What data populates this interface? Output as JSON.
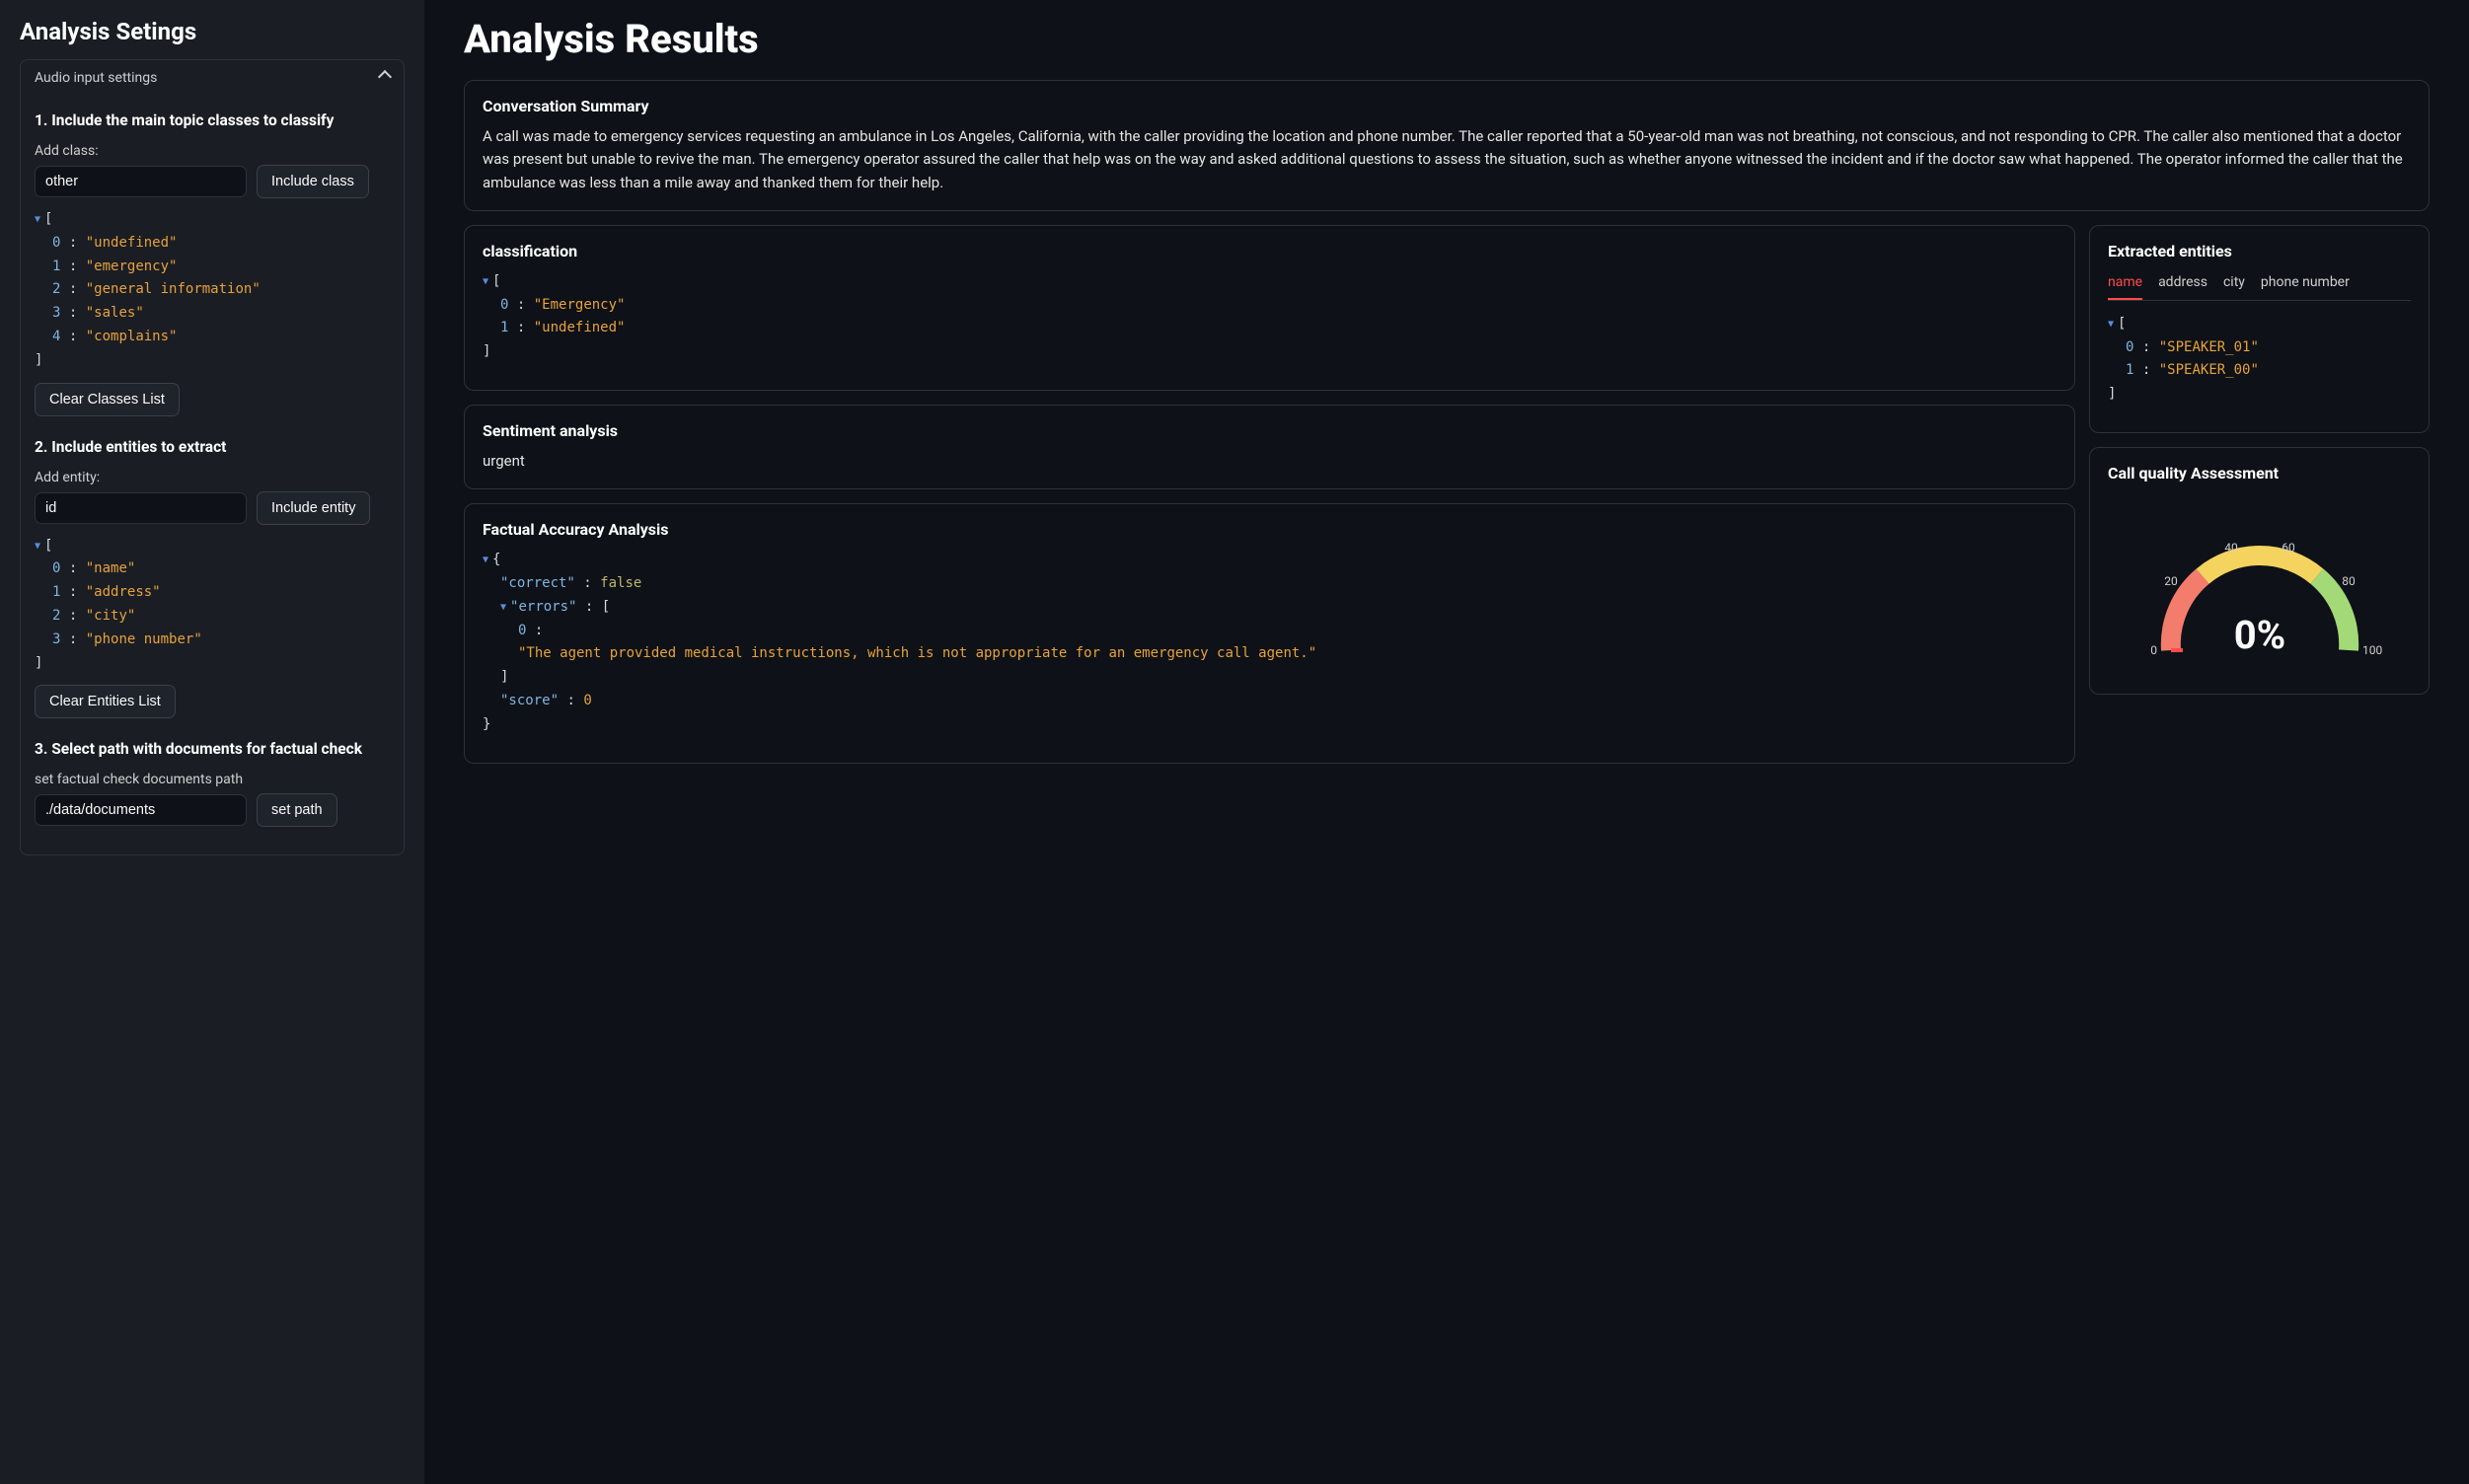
{
  "sidebar": {
    "title": "Analysis Setings",
    "accordion_label": "Audio input settings",
    "section1": {
      "title": "1. Include the main topic classes to classify",
      "add_label": "Add class:",
      "input_value": "other",
      "include_btn": "Include class",
      "classes": [
        "undefined",
        "emergency",
        "general information",
        "sales",
        "complains"
      ],
      "clear_btn": "Clear Classes List"
    },
    "section2": {
      "title": "2. Include entities to extract",
      "add_label": "Add entity:",
      "input_value": "id",
      "include_btn": "Include entity",
      "entities": [
        "name",
        "address",
        "city",
        "phone number"
      ],
      "clear_btn": "Clear Entities List"
    },
    "section3": {
      "title": "3. Select path with documents for factual check",
      "add_label": "set factual check documents path",
      "input_value": "./data/documents",
      "set_btn": "set path"
    }
  },
  "results": {
    "title": "Analysis Results",
    "summary": {
      "heading": "Conversation Summary",
      "text": "A call was made to emergency services requesting an ambulance in Los Angeles, California, with the caller providing the location and phone number. The caller reported that a 50-year-old man was not breathing, not conscious, and not responding to CPR. The caller also mentioned that a doctor was present but unable to revive the man. The emergency operator assured the caller that help was on the way and asked additional questions to assess the situation, such as whether anyone witnessed the incident and if the doctor saw what happened. The operator informed the caller that the ambulance was less than a mile away and thanked them for their help."
    },
    "classification": {
      "heading": "classification",
      "values": [
        "Emergency",
        "undefined"
      ]
    },
    "sentiment": {
      "heading": "Sentiment analysis",
      "value": "urgent"
    },
    "factual": {
      "heading": "Factual Accuracy Analysis",
      "correct": false,
      "error_text": "\"The agent provided medical instructions, which is not appropriate for an emergency call agent.\"",
      "score": 0
    },
    "entities": {
      "heading": "Extracted entities",
      "tabs": [
        "name",
        "address",
        "city",
        "phone number"
      ],
      "active_tab": "name",
      "values": [
        "SPEAKER_01",
        "SPEAKER_00"
      ]
    },
    "quality": {
      "heading": "Call quality Assessment",
      "ticks": {
        "t0": "0",
        "t20": "20",
        "t40": "40",
        "t60": "60",
        "t80": "80",
        "t100": "100"
      },
      "display": "0%"
    }
  },
  "chart_data": {
    "type": "gauge",
    "value": 0,
    "range": [
      0,
      100
    ],
    "ticks": [
      0,
      20,
      40,
      60,
      80,
      100
    ],
    "segments": [
      {
        "from": 0,
        "to": 33,
        "color": "#f47c6c"
      },
      {
        "from": 33,
        "to": 66,
        "color": "#f4d35e"
      },
      {
        "from": 66,
        "to": 100,
        "color": "#a3d977"
      }
    ],
    "title": "Call quality Assessment",
    "display_label": "0%"
  }
}
